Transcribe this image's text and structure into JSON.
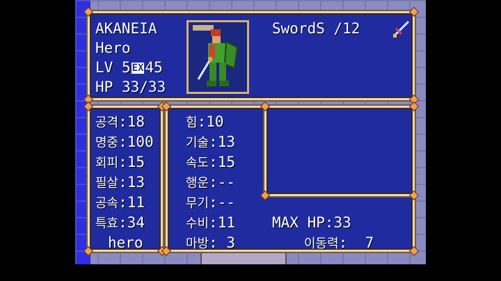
{
  "unit": {
    "name": "AKANEIA",
    "class": "Hero",
    "lv_label": "LV",
    "level": "5",
    "ex_label": "EX",
    "exp": "45",
    "hp_label": "HP",
    "hp": "33/33"
  },
  "weapon": {
    "name": "SwordS",
    "uses": "/12",
    "icon": "sword-icon"
  },
  "combat_stats": [
    {
      "label": "공격",
      "value": ":18"
    },
    {
      "label": "명중",
      "value": ":100"
    },
    {
      "label": "회피",
      "value": ":15"
    },
    {
      "label": "필살",
      "value": ":13"
    },
    {
      "label": "공속",
      "value": ":11"
    },
    {
      "label": "특효",
      "value": ":34"
    }
  ],
  "special_effect": "hero",
  "base_stats": [
    {
      "label": "힘",
      "value": ":10"
    },
    {
      "label": "기술",
      "value": ":13"
    },
    {
      "label": "속도",
      "value": ":15"
    },
    {
      "label": "행운",
      "value": ":--"
    },
    {
      "label": "무기",
      "value": ":--"
    },
    {
      "label": "수비",
      "value": ":11"
    },
    {
      "label": "마방",
      "value": ": 3"
    }
  ],
  "max_hp": {
    "label": "MAX HP",
    "value": ":33"
  },
  "move": {
    "label": "이동력",
    "value": ":  7"
  },
  "colors": {
    "panel_bg": "#1f2b9e",
    "border": "#e9d9b4",
    "text": "#ffffff",
    "map_water": "#2f2fe0"
  }
}
